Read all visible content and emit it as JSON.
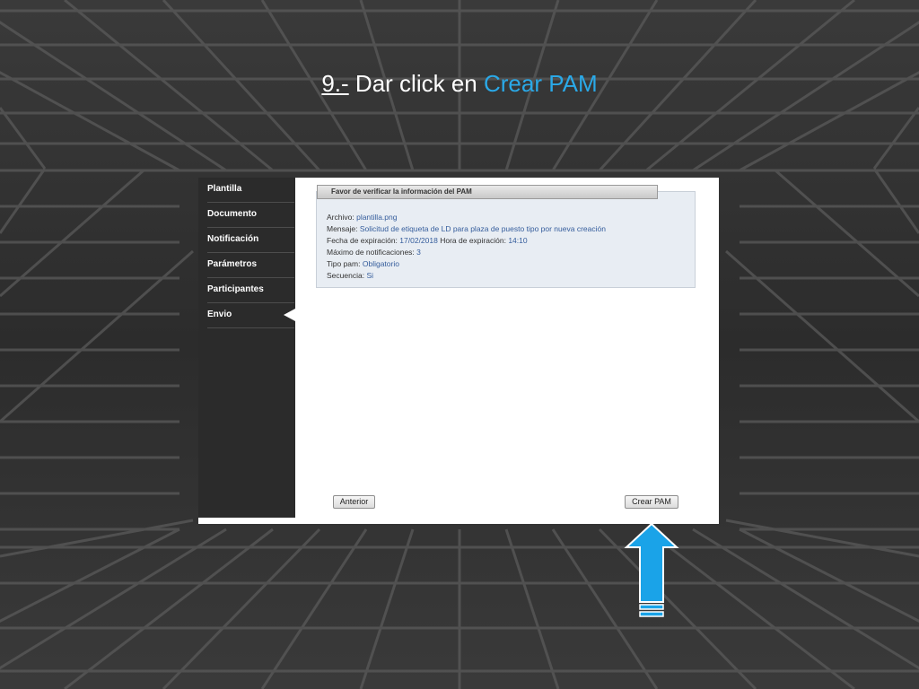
{
  "slide": {
    "step_number": "9.-",
    "instruction": "Dar click en",
    "target": "Crear PAM"
  },
  "sidebar": {
    "items": [
      {
        "label": "Plantilla"
      },
      {
        "label": "Documento"
      },
      {
        "label": "Notificación"
      },
      {
        "label": "Parámetros"
      },
      {
        "label": "Participantes"
      },
      {
        "label": "Envio",
        "active": true
      }
    ]
  },
  "panel": {
    "header": "Favor de verificar la información del PAM",
    "archivo_label": "Archivo:",
    "archivo_value": "plantilla.png",
    "mensaje_label": "Mensaje:",
    "mensaje_value": "Solicitud de etiqueta de LD para plaza de puesto tipo por nueva creación",
    "fecha_label": "Fecha de expiración:",
    "fecha_value": "17/02/2018",
    "hora_label": "Hora de expiración:",
    "hora_value": "14:10",
    "maximo_label": "Máximo de notificaciones:",
    "maximo_value": "3",
    "tipo_label": "Tipo pam:",
    "tipo_value": "Obligatorio",
    "secuencia_label": "Secuencia:",
    "secuencia_value": "Si"
  },
  "buttons": {
    "previous": "Anterior",
    "create": "Crear PAM"
  },
  "colors": {
    "accent": "#2aa9e8",
    "arrow": "#1aa3e8",
    "sidebar": "#2b2b2b",
    "panel": "#e8edf3"
  }
}
